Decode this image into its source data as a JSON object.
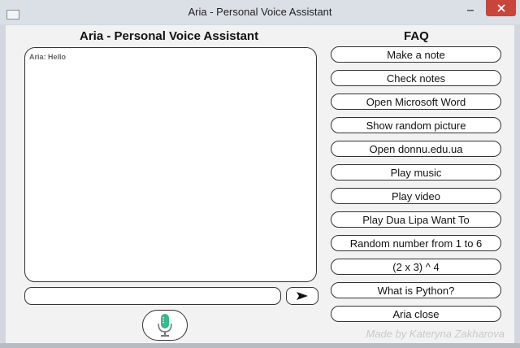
{
  "window": {
    "title": "Aria - Personal Voice Assistant"
  },
  "main": {
    "heading": "Aria - Personal Voice Assistant"
  },
  "chat": {
    "messages": [
      "Aria: Hello"
    ]
  },
  "input": {
    "value": ""
  },
  "faq": {
    "heading": "FAQ",
    "items": [
      "Make a note",
      "Check notes",
      "Open Microsoft Word",
      "Show random picture",
      "Open donnu.edu.ua",
      "Play music",
      "Play video",
      "Play Dua Lipa Want To",
      "Random number from 1 to 6",
      "(2 x 3) ^ 4",
      "What is Python?",
      "Aria close"
    ]
  },
  "footer": {
    "credit": "Made by Kateryna Zakharova"
  },
  "colors": {
    "mic_accent": "#38b88d",
    "close_button": "#c7453b"
  },
  "icons": {
    "send": "send-arrow-icon",
    "mic": "microphone-icon",
    "app": "window-app-icon"
  }
}
